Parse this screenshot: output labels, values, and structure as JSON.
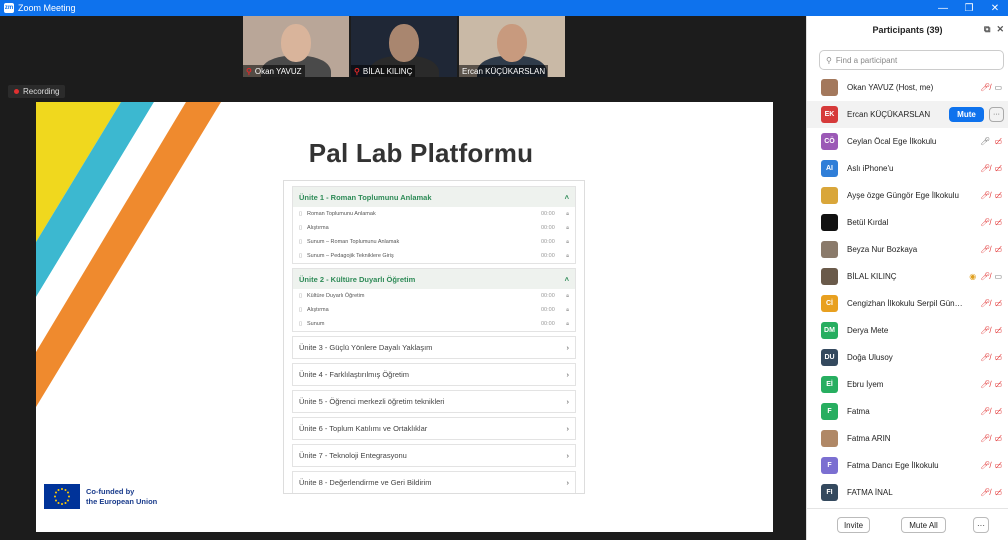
{
  "window": {
    "title": "Zoom Meeting",
    "minimize": "—",
    "maximize": "❐",
    "close": "✕"
  },
  "video_tiles": [
    {
      "name": "Okan YAVUZ",
      "bg": "#b9a698",
      "head": "#d9b49b",
      "body": "#4a4a4a"
    },
    {
      "name": "BİLAL KILINÇ",
      "bg": "#1f2736",
      "head": "#a9866f",
      "body": "#2a2a2a"
    },
    {
      "name": "Ercan KÜÇÜKARSLAN",
      "bg": "#c9b9a6",
      "head": "#c89a7e",
      "body": "#2f3b4a"
    }
  ],
  "recording": {
    "label": "Recording"
  },
  "slide": {
    "title": "Pal Lab Platformu",
    "units_open": [
      {
        "title": "Ünite 1 - Roman Toplumunu Anlamak",
        "lessons": [
          {
            "title": "Roman Toplumunu Anlamak",
            "dur": "00:00"
          },
          {
            "title": "Alıştırma",
            "dur": "00:00"
          },
          {
            "title": "Sunum – Roman Toplumunu Anlamak",
            "dur": "00:00"
          },
          {
            "title": "Sunum – Pedagojik Tekniklere Giriş",
            "dur": "00:00"
          }
        ]
      },
      {
        "title": "Ünite 2 - Kültüre Duyarlı Öğretim",
        "lessons": [
          {
            "title": "Kültüre Duyarlı Öğretim",
            "dur": "00:00"
          },
          {
            "title": "Alıştırma",
            "dur": "00:00"
          },
          {
            "title": "Sunum",
            "dur": "00:00"
          }
        ]
      }
    ],
    "units_closed": [
      "Ünite 3 - Güçlü Yönlere Dayalı Yaklaşım",
      "Ünite 4 - Farklılaştırılmış Öğretim",
      "Ünite 5 - Öğrenci merkezli öğretim teknikleri",
      "Ünite 6 - Toplum Katılımı ve Ortaklıklar",
      "Ünite 7 - Teknoloji Entegrasyonu",
      "Ünite 8 - Değerlendirme ve Geri Bildirim"
    ],
    "eu": {
      "line1": "Co-funded by",
      "line2": "the European Union"
    }
  },
  "participants_panel": {
    "title": "Participants (39)",
    "search_placeholder": "Find a participant",
    "mute_label": "Mute",
    "more_label": "···",
    "invite_label": "Invite",
    "mute_all_label": "Mute All",
    "items": [
      {
        "initials": "",
        "name": "Okan YAVUZ (Host, me)",
        "color": "#a3785c",
        "mic": "muted",
        "cam": "on"
      },
      {
        "initials": "EK",
        "name": "Ercan KÜÇÜKARSLAN",
        "color": "#d63a3a",
        "mic": "none",
        "cam": "none",
        "hover": true
      },
      {
        "initials": "CÖ",
        "name": "Ceylan Öcal Ege İlkokulu",
        "color": "#9b59b6",
        "mic": "on",
        "cam": "off"
      },
      {
        "initials": "AI",
        "name": "Aslı iPhone'u",
        "color": "#2f7ed8",
        "mic": "muted",
        "cam": "off"
      },
      {
        "initials": "",
        "name": "Ayşe özge Güngör Ege İlkokulu",
        "color": "#d9a63a",
        "mic": "muted",
        "cam": "off"
      },
      {
        "initials": "",
        "name": "Betül Kırdal",
        "color": "#111111",
        "mic": "muted",
        "cam": "off"
      },
      {
        "initials": "",
        "name": "Beyza Nur Bozkaya",
        "color": "#8a7a6a",
        "mic": "muted",
        "cam": "off"
      },
      {
        "initials": "",
        "name": "BİLAL KILINÇ",
        "color": "#6a5a4a",
        "mic": "muted",
        "cam": "on",
        "extra": "raise"
      },
      {
        "initials": "Cİ",
        "name": "Cengizhan İlkokulu Serpil Güngö...",
        "color": "#e8a020",
        "mic": "muted",
        "cam": "off"
      },
      {
        "initials": "DM",
        "name": "Derya Mete",
        "color": "#27ae60",
        "mic": "muted",
        "cam": "off"
      },
      {
        "initials": "DU",
        "name": "Doğa Ulusoy",
        "color": "#34495e",
        "mic": "muted",
        "cam": "off"
      },
      {
        "initials": "Eİ",
        "name": "Ebru İyem",
        "color": "#27ae60",
        "mic": "muted",
        "cam": "off"
      },
      {
        "initials": "F",
        "name": "Fatma",
        "color": "#27ae60",
        "mic": "muted",
        "cam": "off"
      },
      {
        "initials": "",
        "name": "Fatma ARIN",
        "color": "#b08866",
        "mic": "muted",
        "cam": "off"
      },
      {
        "initials": "F",
        "name": "Fatma Dancı Ege İlkokulu",
        "color": "#7b6fd1",
        "mic": "muted",
        "cam": "off"
      },
      {
        "initials": "FI",
        "name": "FATMA İNAL",
        "color": "#34495e",
        "mic": "muted",
        "cam": "off"
      }
    ]
  }
}
